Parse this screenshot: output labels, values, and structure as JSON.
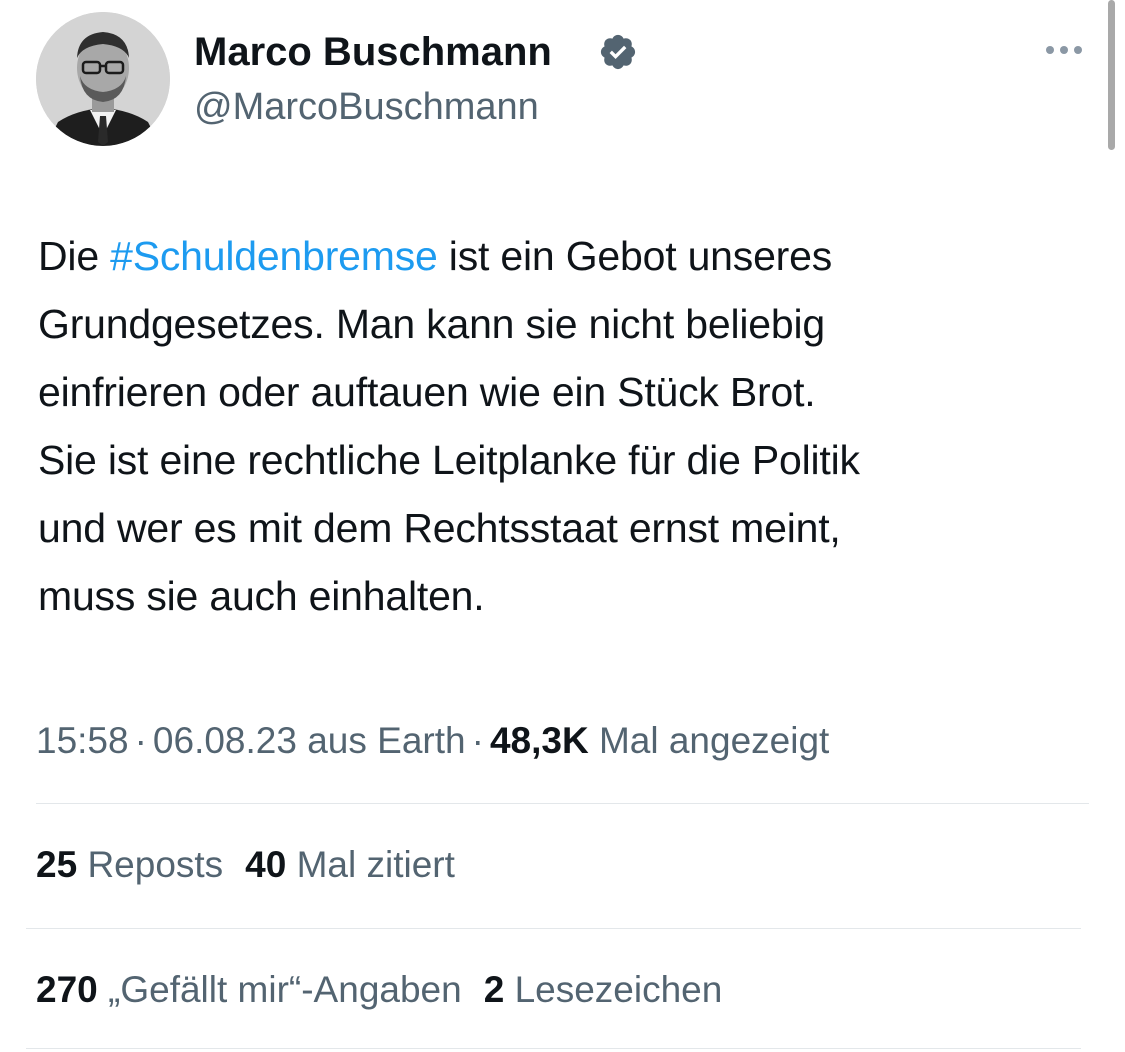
{
  "author": {
    "display_name": "Marco Buschmann",
    "handle": "@MarcoBuschmann",
    "verified": true,
    "verified_color": "#536471"
  },
  "tweet": {
    "lines": [
      {
        "pre": "Die ",
        "hashtag": "#Schuldenbremse",
        "post": " ist ein Gebot unseres"
      },
      {
        "text": "Grundgesetzes. Man kann sie nicht beliebig"
      },
      {
        "text": "einfrieren oder auftauen wie ein Stück Brot."
      },
      {
        "text": "Sie ist eine rechtliche Leitplanke für die Politik"
      },
      {
        "text": "und wer es mit dem Rechtsstaat ernst meint,"
      },
      {
        "text": "muss sie auch einhalten."
      }
    ],
    "hashtag_color": "#1d9bf0"
  },
  "meta": {
    "time": "15:58",
    "separator": "·",
    "date_source": "06.08.23 aus Earth",
    "views_count": "48,3K",
    "views_label": "Mal angezeigt"
  },
  "stats_row1": {
    "reposts_count": "25",
    "reposts_label": "Reposts",
    "quotes_count": "40",
    "quotes_label": "Mal zitiert"
  },
  "stats_row2": {
    "likes_count": "270",
    "likes_label": "„Gefällt mir“-Angaben",
    "bookmarks_count": "2",
    "bookmarks_label": "Lesezeichen"
  },
  "icons": {
    "more": "more-dots-icon",
    "verified": "verified-badge-icon"
  },
  "colors": {
    "text_primary": "#0f1419",
    "text_secondary": "#536471",
    "divider": "#e3e7ea"
  }
}
